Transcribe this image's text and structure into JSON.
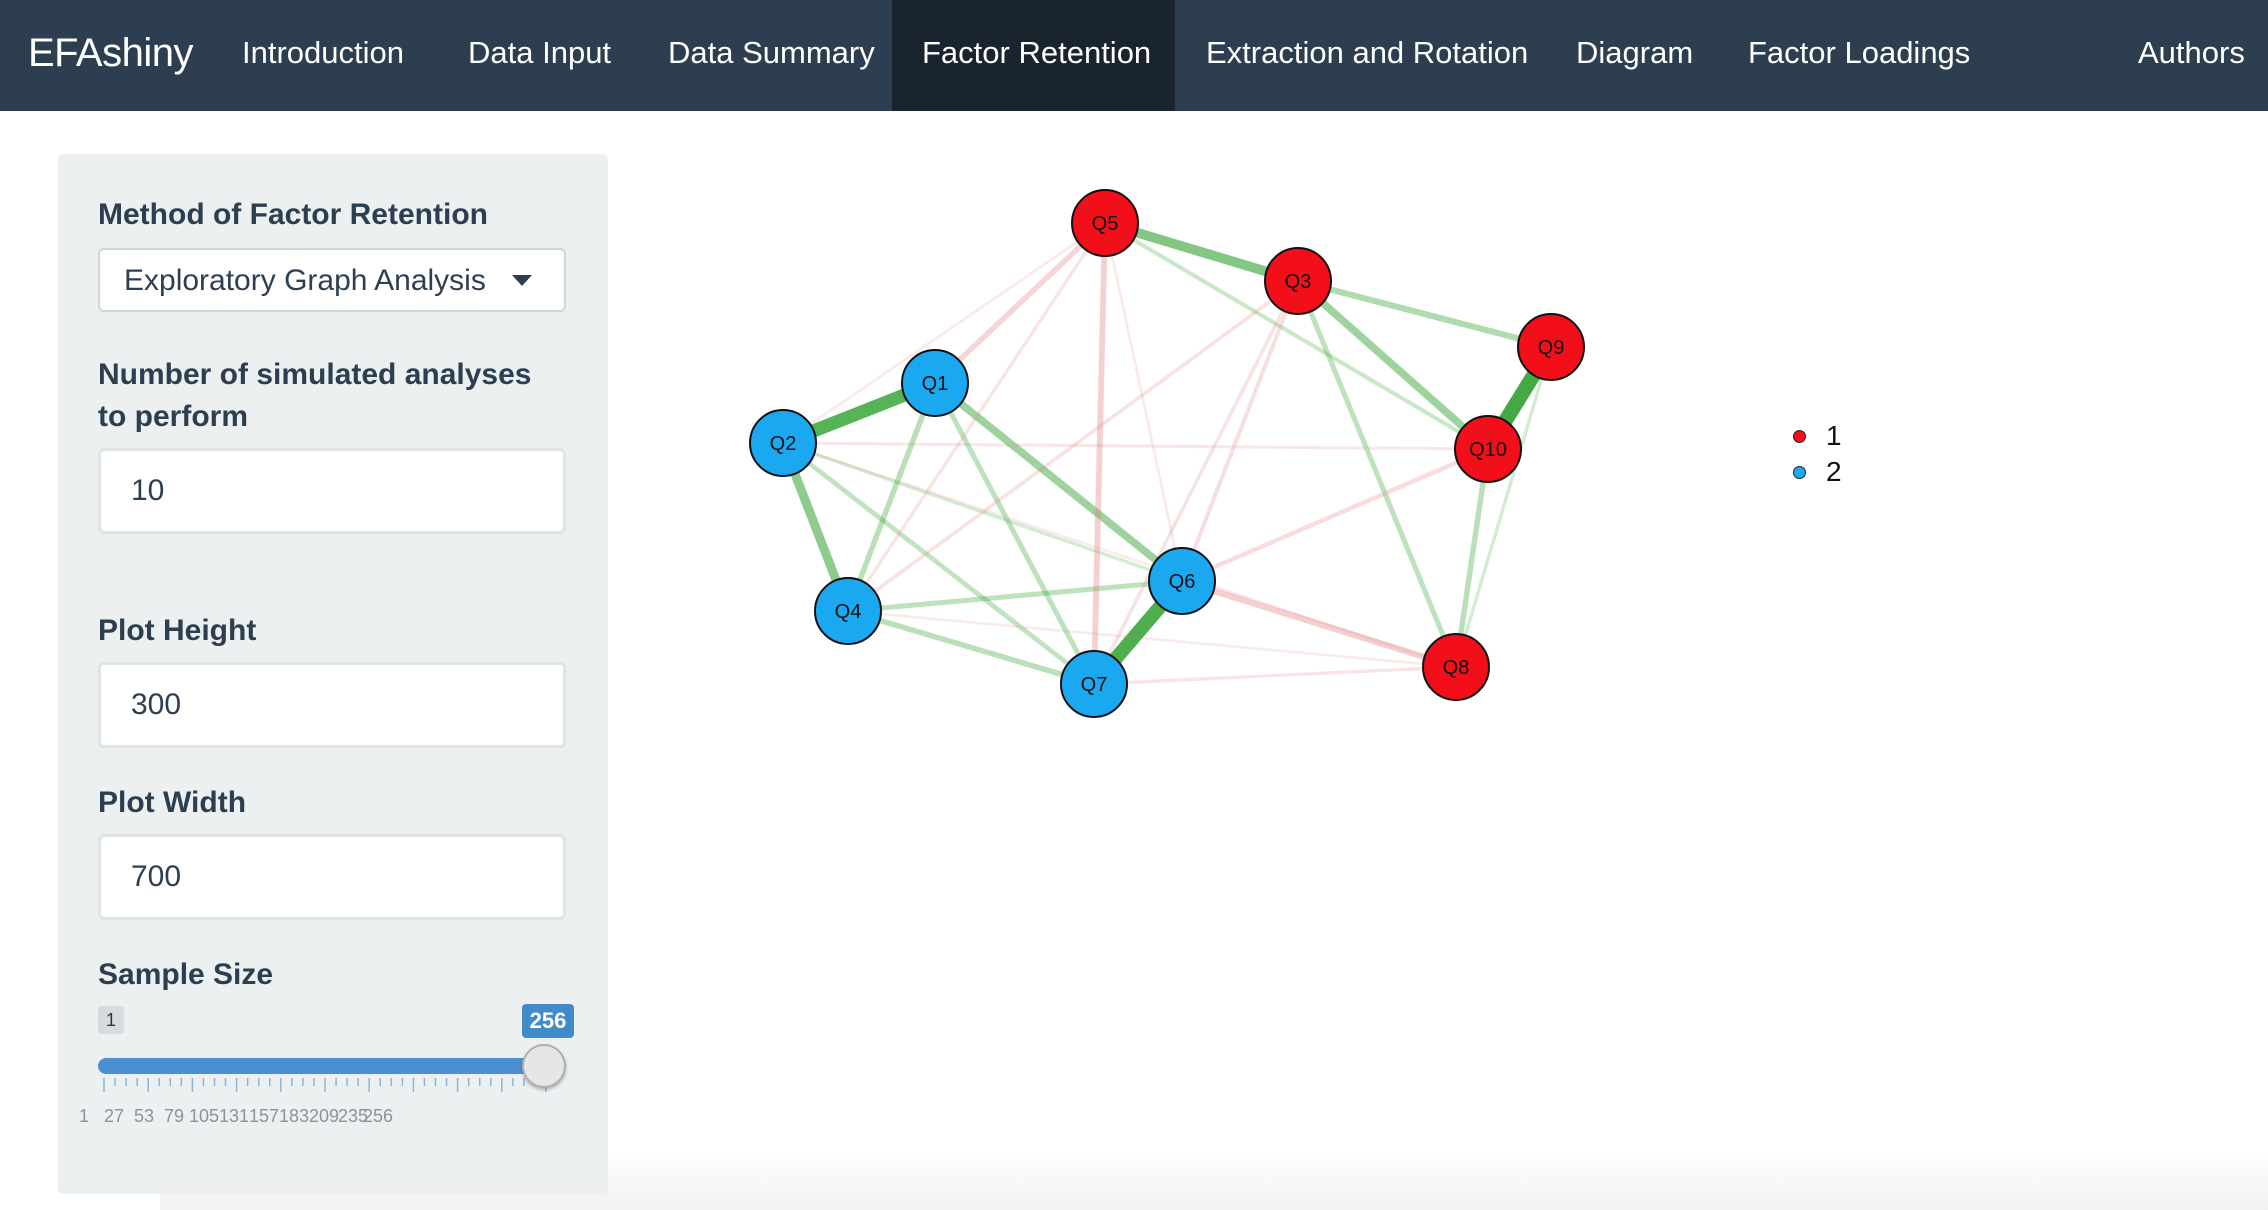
{
  "navbar": {
    "brand": "EFAshiny",
    "tabs": [
      {
        "label": "Introduction"
      },
      {
        "label": "Data Input"
      },
      {
        "label": "Data Summary"
      },
      {
        "label": "Factor Retention",
        "active": true
      },
      {
        "label": "Extraction and Rotation"
      },
      {
        "label": "Diagram"
      },
      {
        "label": "Factor Loadings"
      },
      {
        "label": "Authors"
      }
    ]
  },
  "sidebar": {
    "method_label": "Method of Factor Retention",
    "method_value": "Exploratory Graph Analysis",
    "simulations_label": "Number of simulated analyses to perform",
    "simulations_value": "10",
    "plot_height_label": "Plot Height",
    "plot_height_value": "300",
    "plot_width_label": "Plot Width",
    "plot_width_value": "700",
    "sample_size_label": "Sample Size",
    "slider": {
      "min": "1",
      "max": "256",
      "value": "256",
      "tick_labels": [
        "1",
        "27",
        "53",
        "79",
        "105",
        "131",
        "157",
        "183",
        "209",
        "235",
        "256"
      ]
    }
  },
  "graph": {
    "colors": {
      "1": "#f20f1a",
      "2": "#1aa9f0",
      "positive_edge": "#2ca02c",
      "negative_edge": "#e08080"
    },
    "nodes": [
      {
        "id": "Q5",
        "group": "1"
      },
      {
        "id": "Q3",
        "group": "1"
      },
      {
        "id": "Q9",
        "group": "1"
      },
      {
        "id": "Q10",
        "group": "1"
      },
      {
        "id": "Q8",
        "group": "1"
      },
      {
        "id": "Q1",
        "group": "2"
      },
      {
        "id": "Q2",
        "group": "2"
      },
      {
        "id": "Q4",
        "group": "2"
      },
      {
        "id": "Q6",
        "group": "2"
      },
      {
        "id": "Q7",
        "group": "2"
      }
    ],
    "edges": [
      {
        "a": "Q5",
        "b": "Q3",
        "sign": "+",
        "strength": 0.55
      },
      {
        "a": "Q9",
        "b": "Q10",
        "sign": "+",
        "strength": 0.9
      },
      {
        "a": "Q1",
        "b": "Q2",
        "sign": "+",
        "strength": 0.8
      },
      {
        "a": "Q6",
        "b": "Q7",
        "sign": "+",
        "strength": 0.85
      },
      {
        "a": "Q2",
        "b": "Q4",
        "sign": "+",
        "strength": 0.5
      },
      {
        "a": "Q3",
        "b": "Q10",
        "sign": "+",
        "strength": 0.4
      },
      {
        "a": "Q1",
        "b": "Q6",
        "sign": "+",
        "strength": 0.4
      },
      {
        "a": "Q3",
        "b": "Q9",
        "sign": "+",
        "strength": 0.3
      },
      {
        "a": "Q1",
        "b": "Q4",
        "sign": "+",
        "strength": 0.25
      },
      {
        "a": "Q1",
        "b": "Q7",
        "sign": "+",
        "strength": 0.22
      },
      {
        "a": "Q2",
        "b": "Q7",
        "sign": "+",
        "strength": 0.2
      },
      {
        "a": "Q4",
        "b": "Q7",
        "sign": "+",
        "strength": 0.25
      },
      {
        "a": "Q4",
        "b": "Q6",
        "sign": "+",
        "strength": 0.22
      },
      {
        "a": "Q3",
        "b": "Q8",
        "sign": "+",
        "strength": 0.22
      },
      {
        "a": "Q10",
        "b": "Q8",
        "sign": "+",
        "strength": 0.25
      },
      {
        "a": "Q5",
        "b": "Q10",
        "sign": "+",
        "strength": 0.15
      },
      {
        "a": "Q9",
        "b": "Q8",
        "sign": "+",
        "strength": 0.1
      },
      {
        "a": "Q2",
        "b": "Q6",
        "sign": "+",
        "strength": 0.1
      },
      {
        "a": "Q6",
        "b": "Q8",
        "sign": "-",
        "strength": 0.3
      },
      {
        "a": "Q5",
        "b": "Q7",
        "sign": "-",
        "strength": 0.28
      },
      {
        "a": "Q5",
        "b": "Q1",
        "sign": "-",
        "strength": 0.25
      },
      {
        "a": "Q6",
        "b": "Q10",
        "sign": "-",
        "strength": 0.18
      },
      {
        "a": "Q3",
        "b": "Q6",
        "sign": "-",
        "strength": 0.15
      },
      {
        "a": "Q3",
        "b": "Q7",
        "sign": "-",
        "strength": 0.12
      },
      {
        "a": "Q3",
        "b": "Q4",
        "sign": "-",
        "strength": 0.12
      },
      {
        "a": "Q5",
        "b": "Q4",
        "sign": "-",
        "strength": 0.1
      },
      {
        "a": "Q2",
        "b": "Q10",
        "sign": "-",
        "strength": 0.08
      },
      {
        "a": "Q7",
        "b": "Q8",
        "sign": "-",
        "strength": 0.1
      },
      {
        "a": "Q5",
        "b": "Q2",
        "sign": "-",
        "strength": 0.06
      },
      {
        "a": "Q5",
        "b": "Q6",
        "sign": "-",
        "strength": 0.06
      },
      {
        "a": "Q4",
        "b": "Q8",
        "sign": "-",
        "strength": 0.05
      },
      {
        "a": "Q2",
        "b": "Q8",
        "sign": "-",
        "strength": 0.05
      }
    ],
    "legend": [
      {
        "label": "1",
        "color": "#f20f1a"
      },
      {
        "label": "2",
        "color": "#1aa9f0"
      }
    ]
  }
}
